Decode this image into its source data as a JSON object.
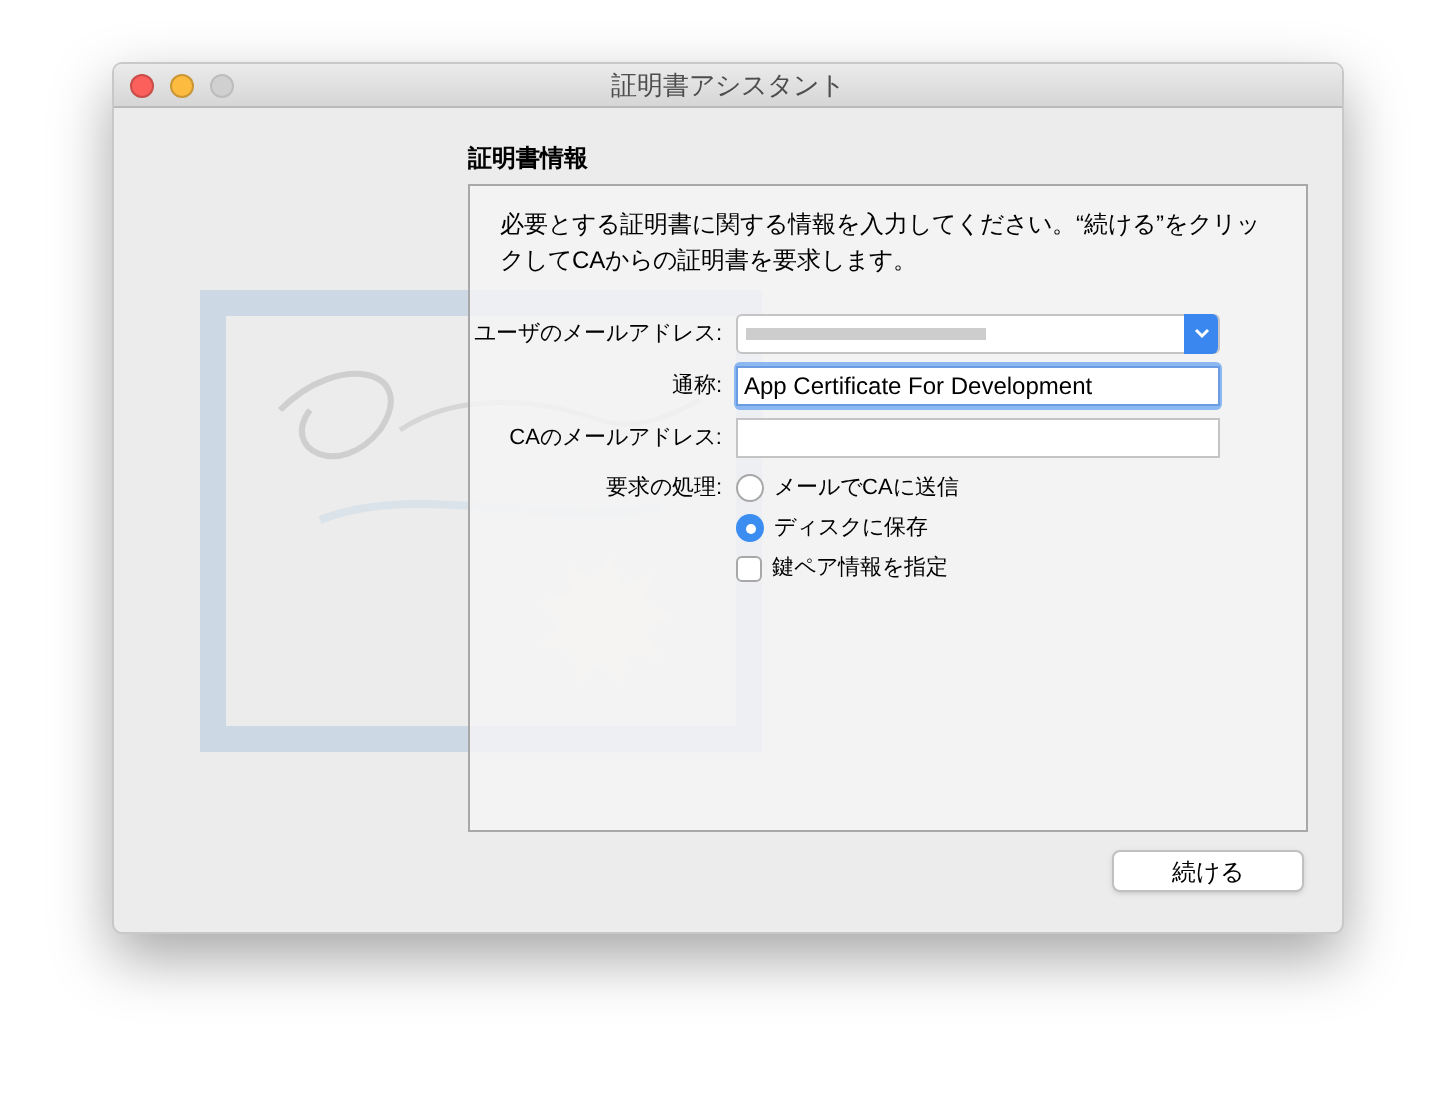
{
  "window": {
    "title": "証明書アシスタント",
    "controls": [
      {
        "kind": "close",
        "disabled": false
      },
      {
        "kind": "minimize",
        "disabled": false
      },
      {
        "kind": "zoom",
        "disabled": true
      }
    ]
  },
  "section_title": "証明書情報",
  "intro": "必要とする証明書に関する情報を入力してください。“続ける”をクリックしてCAからの証明書を要求します。",
  "fields": [
    {
      "kind": "select",
      "label": "ユーザのメールアドレス:",
      "focused": false
    },
    {
      "kind": "text",
      "label": "通称:",
      "value": "App Certificate For Development",
      "focused": true
    },
    {
      "kind": "text",
      "label": "CAのメールアドレス:",
      "focused": false
    }
  ],
  "request": {
    "label": "要求の処理:",
    "options": [
      {
        "label": "メールでCAに送信",
        "selected": false
      },
      {
        "label": "ディスクに保存",
        "selected": true
      }
    ]
  },
  "key_pair": {
    "label": "鍵ペア情報を指定",
    "checked": false
  },
  "continue_button": "続ける"
}
